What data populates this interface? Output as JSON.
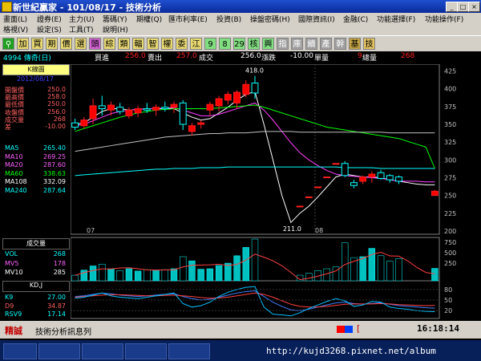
{
  "window": {
    "title": "新世紀贏家 - 101/08/17 - 技術分析"
  },
  "menu": {
    "row1": [
      "畫面(L)",
      "證券(E)",
      "主力(U)",
      "籌碼(Y)",
      "期權(Q)",
      "匯市利率(E)",
      "投資(B)",
      "操盤密碼(H)",
      "國際資訊(I)",
      "金融(C)",
      "功能選擇(F)",
      "功能操作(F)"
    ],
    "row2": [
      "格視(V)",
      "設定(S)",
      "工具(T)",
      "說明(H)"
    ]
  },
  "toolbar": {
    "buttons": [
      "加",
      "買",
      "期",
      "價",
      "選",
      "頭",
      "綜",
      "類",
      "輻",
      "智",
      "權",
      "委",
      "江",
      "9",
      "8",
      "29",
      "核",
      "興",
      "指",
      "庫",
      "續",
      "產",
      "幹",
      "基",
      "技"
    ]
  },
  "quote": {
    "symbol": "4994 傳奇(日)",
    "bid_label": "買進",
    "bid": "256.0",
    "ask_label": "賣出",
    "ask": "257.0",
    "trade_label": "成交",
    "trade": "256.0",
    "change_label": "漲跌",
    "change": "-10.00",
    "single_label": "單量",
    "single": "9",
    "total_label": "總量",
    "total": "268"
  },
  "panel": {
    "title": "K線圖",
    "date": "2012/08/17",
    "ohlc": [
      {
        "label": "開盤價",
        "value": "250.0"
      },
      {
        "label": "最高價",
        "value": "258.0"
      },
      {
        "label": "最低價",
        "value": "250.0"
      },
      {
        "label": "收盤價",
        "value": "256.0"
      },
      {
        "label": "成交量",
        "value": "268"
      },
      {
        "label": "差",
        "value": "-10.00"
      }
    ],
    "ma": [
      {
        "label": "MA5",
        "value": "265.40"
      },
      {
        "label": "MA10",
        "value": "269.25"
      },
      {
        "label": "MA20",
        "value": "287.60"
      },
      {
        "label": "MA60",
        "value": "338.63"
      },
      {
        "label": "MA108",
        "value": "332.09"
      },
      {
        "label": "MA240",
        "value": "287.64"
      }
    ],
    "volume_title": "成交量",
    "vol": [
      {
        "label": "VOL",
        "value": "268"
      },
      {
        "label": "MV5",
        "value": "178"
      },
      {
        "label": "MV10",
        "value": "285"
      }
    ],
    "kd_title": "KD,J",
    "kd": [
      {
        "label": "K9",
        "value": "27.00"
      },
      {
        "label": "D9",
        "value": "34.87"
      },
      {
        "label": "RSV9",
        "value": "17.14"
      }
    ]
  },
  "colors": {
    "up": "#ff2020",
    "down": "#00ffff",
    "ma5": "#ffffff",
    "ma10": "#ff40ff",
    "ma20": "#00ff00",
    "ma60": "#ffffff",
    "ma240": "#00ffff"
  },
  "chart": {
    "price_ticks": [
      "425",
      "400",
      "375",
      "350",
      "325",
      "300",
      "275",
      "250",
      "225",
      "200"
    ],
    "high_label": "418.0",
    "low_label": "211.0",
    "x_labels": [
      "07",
      "08"
    ],
    "vol_ticks": [
      "750",
      "500",
      "250"
    ],
    "kd_ticks": [
      "80",
      "50",
      "20"
    ]
  },
  "status": {
    "left": "精誠",
    "message": "技術分析訊息列",
    "bracket": "[",
    "time": "16:18:14"
  },
  "watermark": "http://kujd3268.pixnet.net/album",
  "chart_data": {
    "type": "candlestick",
    "price_range": [
      200,
      430
    ],
    "candles": [
      {
        "o": 352,
        "h": 358,
        "l": 342,
        "c": 346
      },
      {
        "o": 348,
        "h": 360,
        "l": 344,
        "c": 356
      },
      {
        "o": 358,
        "h": 386,
        "l": 350,
        "c": 376
      },
      {
        "o": 376,
        "h": 390,
        "l": 362,
        "c": 372
      },
      {
        "o": 370,
        "h": 382,
        "l": 362,
        "c": 377
      },
      {
        "o": 374,
        "h": 380,
        "l": 364,
        "c": 368
      },
      {
        "o": 362,
        "h": 374,
        "l": 358,
        "c": 370
      },
      {
        "o": 366,
        "h": 376,
        "l": 360,
        "c": 372
      },
      {
        "o": 372,
        "h": 380,
        "l": 366,
        "c": 370
      },
      {
        "o": 370,
        "h": 378,
        "l": 362,
        "c": 374
      },
      {
        "o": 374,
        "h": 382,
        "l": 368,
        "c": 372
      },
      {
        "o": 374,
        "h": 382,
        "l": 366,
        "c": 378
      },
      {
        "o": 380,
        "h": 384,
        "l": 342,
        "c": 350
      },
      {
        "o": 340,
        "h": 352,
        "l": 334,
        "c": 348
      },
      {
        "o": 350,
        "h": 356,
        "l": 344,
        "c": 352
      },
      {
        "o": 370,
        "h": 382,
        "l": 362,
        "c": 378
      },
      {
        "o": 376,
        "h": 390,
        "l": 368,
        "c": 386
      },
      {
        "o": 384,
        "h": 396,
        "l": 378,
        "c": 392
      },
      {
        "o": 380,
        "h": 398,
        "l": 372,
        "c": 395
      },
      {
        "o": 392,
        "h": 412,
        "l": 388,
        "c": 406
      },
      {
        "o": 408,
        "h": 418,
        "l": 386,
        "c": 394
      },
      {
        "o": null
      },
      {
        "o": null
      },
      {
        "o": null
      },
      {
        "o": null
      },
      {
        "o": 235,
        "h": 235,
        "l": 235,
        "c": 235
      },
      {
        "o": 248,
        "h": 248,
        "l": 248,
        "c": 248
      },
      {
        "o": 262,
        "h": 262,
        "l": 262,
        "c": 262
      },
      {
        "o": 276,
        "h": 276,
        "l": 276,
        "c": 276
      },
      {
        "o": 295,
        "h": 295,
        "l": 295,
        "c": 295
      },
      {
        "o": 295,
        "h": 298,
        "l": 276,
        "c": 278
      },
      {
        "o": 268,
        "h": 272,
        "l": 260,
        "c": 264
      },
      {
        "o": 270,
        "h": 278,
        "l": 266,
        "c": 276
      },
      {
        "o": 276,
        "h": 284,
        "l": 268,
        "c": 280
      },
      {
        "o": 282,
        "h": 286,
        "l": 272,
        "c": 274
      },
      {
        "o": 278,
        "h": 280,
        "l": 268,
        "c": 272
      },
      {
        "o": 276,
        "h": 278,
        "l": 266,
        "c": 270
      },
      {
        "o": null
      },
      {
        "o": null
      },
      {
        "o": null
      },
      {
        "o": 250,
        "h": 258,
        "l": 250,
        "c": 256
      }
    ],
    "ma_lines": {
      "ma5": [
        350,
        352,
        360,
        368,
        372,
        372,
        370,
        371,
        372,
        372,
        372,
        372,
        366,
        360,
        356,
        358,
        366,
        374,
        384,
        392,
        396,
        350,
        300,
        250,
        212,
        225,
        235,
        248,
        262,
        276,
        280,
        278,
        276,
        276,
        275,
        272,
        270,
        268,
        266,
        265,
        265
      ],
      "ma10": [
        348,
        350,
        355,
        360,
        365,
        368,
        370,
        371,
        372,
        372,
        373,
        373,
        370,
        366,
        362,
        362,
        364,
        368,
        372,
        376,
        380,
        370,
        356,
        340,
        324,
        310,
        300,
        292,
        285,
        280,
        278,
        277,
        276,
        275,
        274,
        272,
        270,
        270,
        270,
        269,
        269
      ],
      "ma20": [
        340,
        344,
        348,
        352,
        356,
        360,
        363,
        366,
        368,
        370,
        371,
        372,
        372,
        372,
        372,
        372,
        373,
        374,
        375,
        376,
        377,
        374,
        370,
        366,
        362,
        358,
        354,
        350,
        346,
        344,
        342,
        340,
        338,
        336,
        334,
        332,
        330,
        326,
        322,
        318,
        288
      ],
      "ma60": [
        312,
        314,
        316,
        318,
        320,
        322,
        324,
        326,
        328,
        330,
        332,
        333,
        334,
        335,
        336,
        337,
        337,
        338,
        338,
        338,
        339,
        340,
        340,
        340,
        340,
        339,
        339,
        339,
        339,
        339,
        339,
        339,
        339,
        339,
        339,
        338,
        338,
        338,
        338,
        338,
        338
      ],
      "ma240": [
        278,
        279,
        280,
        281,
        282,
        283,
        284,
        285,
        286,
        287,
        287,
        288,
        288,
        288,
        289,
        289,
        289,
        290,
        290,
        290,
        290,
        290,
        290,
        290,
        290,
        290,
        290,
        290,
        290,
        290,
        289,
        289,
        289,
        289,
        288,
        288,
        288,
        288,
        288,
        288,
        288
      ]
    },
    "volume": [
      120,
      230,
      320,
      360,
      250,
      220,
      260,
      210,
      240,
      230,
      240,
      260,
      520,
      430,
      250,
      260,
      330,
      380,
      540,
      720,
      900,
      0,
      0,
      0,
      0,
      120,
      160,
      220,
      260,
      300,
      820,
      500,
      520,
      700,
      540,
      420,
      480,
      0,
      0,
      0,
      268
    ],
    "volume_colors_up": [
      false,
      true,
      true,
      false,
      true,
      false,
      true,
      true,
      false,
      true,
      false,
      true,
      false,
      true,
      true,
      true,
      true,
      true,
      true,
      true,
      false,
      false,
      false,
      false,
      false,
      false,
      false,
      false,
      false,
      false,
      false,
      false,
      true,
      true,
      false,
      false,
      false,
      false,
      false,
      false,
      true
    ],
    "kd_k": [
      60,
      62,
      66,
      70,
      68,
      64,
      62,
      60,
      62,
      64,
      66,
      68,
      60,
      54,
      50,
      52,
      58,
      64,
      70,
      74,
      76,
      60,
      44,
      32,
      22,
      20,
      24,
      30,
      36,
      42,
      44,
      40,
      38,
      40,
      42,
      38,
      34,
      32,
      30,
      28,
      27
    ],
    "kd_d": [
      58,
      60,
      62,
      64,
      65,
      65,
      64,
      63,
      62,
      62,
      63,
      64,
      62,
      60,
      57,
      55,
      56,
      58,
      62,
      66,
      70,
      66,
      58,
      48,
      38,
      32,
      30,
      30,
      32,
      35,
      38,
      39,
      39,
      39,
      40,
      39,
      37,
      36,
      35,
      34,
      35
    ],
    "kd_rsv": [
      55,
      58,
      64,
      70,
      62,
      58,
      56,
      54,
      58,
      62,
      66,
      70,
      40,
      30,
      34,
      44,
      60,
      72,
      80,
      86,
      88,
      30,
      10,
      8,
      5,
      14,
      26,
      36,
      46,
      54,
      48,
      32,
      36,
      46,
      44,
      30,
      26,
      24,
      20,
      18,
      17
    ]
  }
}
